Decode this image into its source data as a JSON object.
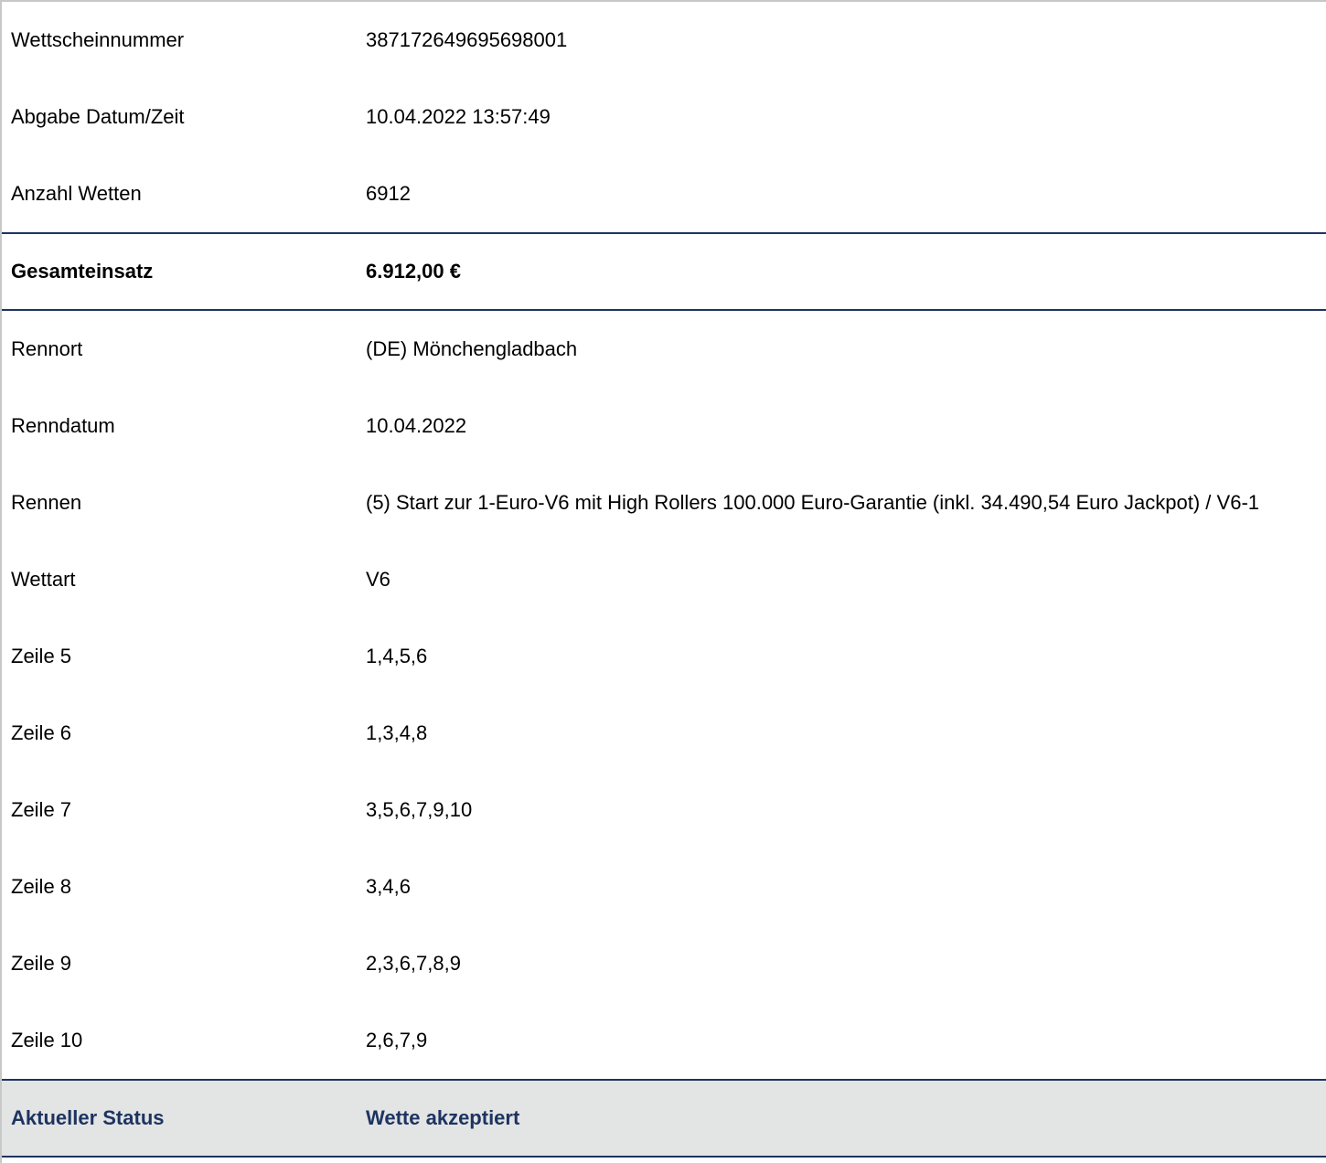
{
  "ticket": {
    "rows_top": [
      {
        "label": "Wettscheinnummer",
        "value": "387172649695698001"
      },
      {
        "label": "Abgabe Datum/Zeit",
        "value": "10.04.2022 13:57:49"
      },
      {
        "label": "Anzahl Wetten",
        "value": "6912"
      }
    ],
    "total": {
      "label": "Gesamteinsatz",
      "value": "6.912,00 €"
    },
    "rows_detail": [
      {
        "label": "Rennort",
        "value": "(DE) Mönchengladbach"
      },
      {
        "label": "Renndatum",
        "value": "10.04.2022"
      },
      {
        "label": "Rennen",
        "value": "(5) Start zur 1-Euro-V6 mit High Rollers 100.000 Euro-Garantie (inkl. 34.490,54 Euro Jackpot) / V6-1"
      },
      {
        "label": "Wettart",
        "value": "V6"
      },
      {
        "label": "Zeile 5",
        "value": "1,4,5,6"
      },
      {
        "label": "Zeile 6",
        "value": "1,3,4,8"
      },
      {
        "label": "Zeile 7",
        "value": "3,5,6,7,9,10"
      },
      {
        "label": "Zeile 8",
        "value": "3,4,6"
      },
      {
        "label": "Zeile 9",
        "value": "2,3,6,7,8,9"
      },
      {
        "label": "Zeile 10",
        "value": "2,6,7,9"
      }
    ],
    "status": {
      "label": "Aktueller Status",
      "value": "Wette akzeptiert"
    }
  },
  "colors": {
    "accent": "#1d3461",
    "status_background": "#e3e4e4",
    "frame_border": "#c8c8c8"
  }
}
